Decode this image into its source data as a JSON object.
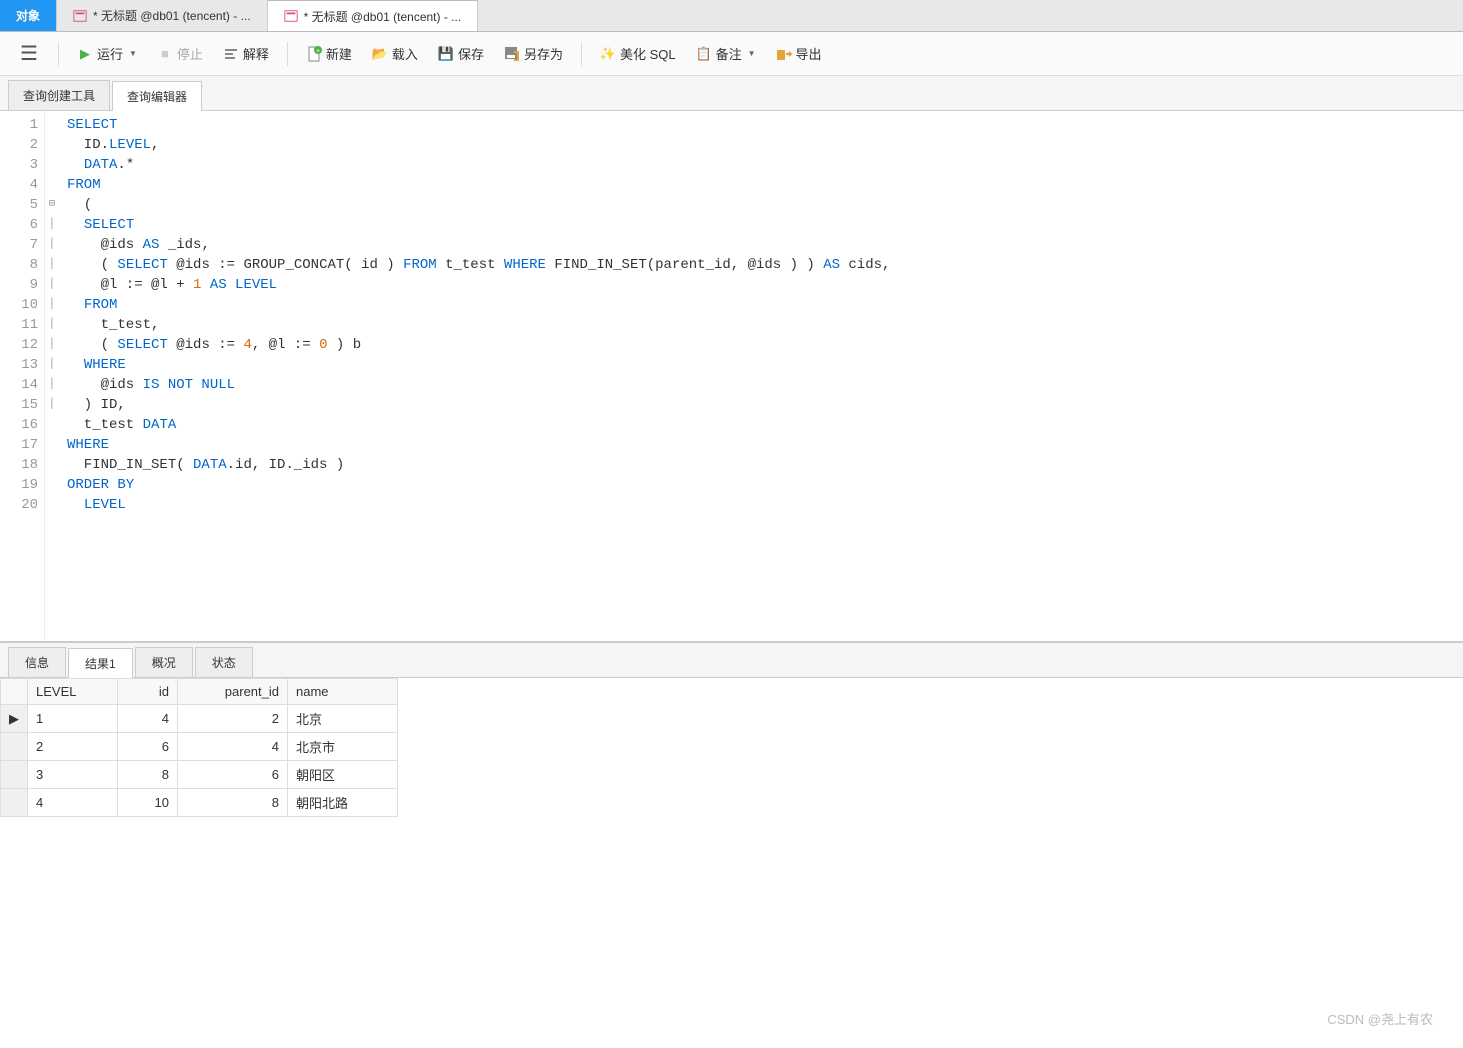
{
  "doc_tabs": [
    {
      "label": "对象",
      "selected": true
    },
    {
      "label": "* 无标题 @db01 (tencent) - ...",
      "selected": false
    },
    {
      "label": "* 无标题 @db01 (tencent) - ...",
      "selected": false,
      "active": true
    }
  ],
  "toolbar": {
    "run": "运行",
    "stop": "停止",
    "explain": "解释",
    "new": "新建",
    "load": "载入",
    "save": "保存",
    "saveas": "另存为",
    "beautify": "美化 SQL",
    "note": "备注",
    "export": "导出"
  },
  "sub_tabs": [
    {
      "label": "查询创建工具",
      "active": false
    },
    {
      "label": "查询编辑器",
      "active": true
    }
  ],
  "code_lines": [
    [
      {
        "c": "kw",
        "t": "SELECT"
      }
    ],
    [
      {
        "c": "",
        "t": "  ID."
      },
      {
        "c": "kw",
        "t": "LEVEL"
      },
      {
        "c": "",
        "t": ","
      }
    ],
    [
      {
        "c": "",
        "t": "  "
      },
      {
        "c": "kw",
        "t": "DATA"
      },
      {
        "c": "",
        "t": ".*"
      }
    ],
    [
      {
        "c": "kw",
        "t": "FROM"
      }
    ],
    [
      {
        "c": "",
        "t": "  ("
      }
    ],
    [
      {
        "c": "",
        "t": "  "
      },
      {
        "c": "kw",
        "t": "SELECT"
      }
    ],
    [
      {
        "c": "",
        "t": "    @ids "
      },
      {
        "c": "kw",
        "t": "AS"
      },
      {
        "c": "",
        "t": " _ids,"
      }
    ],
    [
      {
        "c": "",
        "t": "    ( "
      },
      {
        "c": "kw",
        "t": "SELECT"
      },
      {
        "c": "",
        "t": " @ids := GROUP_CONCAT( id ) "
      },
      {
        "c": "kw",
        "t": "FROM"
      },
      {
        "c": "",
        "t": " t_test "
      },
      {
        "c": "kw",
        "t": "WHERE"
      },
      {
        "c": "",
        "t": " FIND_IN_SET(parent_id, @ids ) ) "
      },
      {
        "c": "kw",
        "t": "AS"
      },
      {
        "c": "",
        "t": " cids,"
      }
    ],
    [
      {
        "c": "",
        "t": "    @l := @l + "
      },
      {
        "c": "num",
        "t": "1"
      },
      {
        "c": "",
        "t": " "
      },
      {
        "c": "kw",
        "t": "AS LEVEL"
      }
    ],
    [
      {
        "c": "",
        "t": "  "
      },
      {
        "c": "kw",
        "t": "FROM"
      }
    ],
    [
      {
        "c": "",
        "t": "    t_test,"
      }
    ],
    [
      {
        "c": "",
        "t": "    ( "
      },
      {
        "c": "kw",
        "t": "SELECT"
      },
      {
        "c": "",
        "t": " @ids := "
      },
      {
        "c": "num",
        "t": "4"
      },
      {
        "c": "",
        "t": ", @l := "
      },
      {
        "c": "num",
        "t": "0"
      },
      {
        "c": "",
        "t": " ) b"
      }
    ],
    [
      {
        "c": "",
        "t": "  "
      },
      {
        "c": "kw",
        "t": "WHERE"
      }
    ],
    [
      {
        "c": "",
        "t": "    @ids "
      },
      {
        "c": "kw",
        "t": "IS NOT NULL"
      }
    ],
    [
      {
        "c": "",
        "t": "  ) ID,"
      }
    ],
    [
      {
        "c": "",
        "t": "  t_test "
      },
      {
        "c": "kw",
        "t": "DATA"
      }
    ],
    [
      {
        "c": "kw",
        "t": "WHERE"
      }
    ],
    [
      {
        "c": "",
        "t": "  FIND_IN_SET( "
      },
      {
        "c": "kw",
        "t": "DATA"
      },
      {
        "c": "",
        "t": ".id, ID._ids )"
      }
    ],
    [
      {
        "c": "kw",
        "t": "ORDER BY"
      }
    ],
    [
      {
        "c": "",
        "t": "  "
      },
      {
        "c": "kw",
        "t": "LEVEL"
      }
    ]
  ],
  "fold_marks": {
    "5": "⊟"
  },
  "result_tabs": [
    {
      "label": "信息",
      "active": false
    },
    {
      "label": "结果1",
      "active": true
    },
    {
      "label": "概况",
      "active": false
    },
    {
      "label": "状态",
      "active": false
    }
  ],
  "result_cols": [
    "LEVEL",
    "id",
    "parent_id",
    "name"
  ],
  "result_rows": [
    {
      "current": true,
      "cells": [
        "1",
        "4",
        "2",
        "北京"
      ]
    },
    {
      "current": false,
      "cells": [
        "2",
        "6",
        "4",
        "北京市"
      ]
    },
    {
      "current": false,
      "cells": [
        "3",
        "8",
        "6",
        "朝阳区"
      ]
    },
    {
      "current": false,
      "cells": [
        "4",
        "10",
        "8",
        "朝阳北路"
      ]
    }
  ],
  "watermark": "CSDN @尧上有农"
}
